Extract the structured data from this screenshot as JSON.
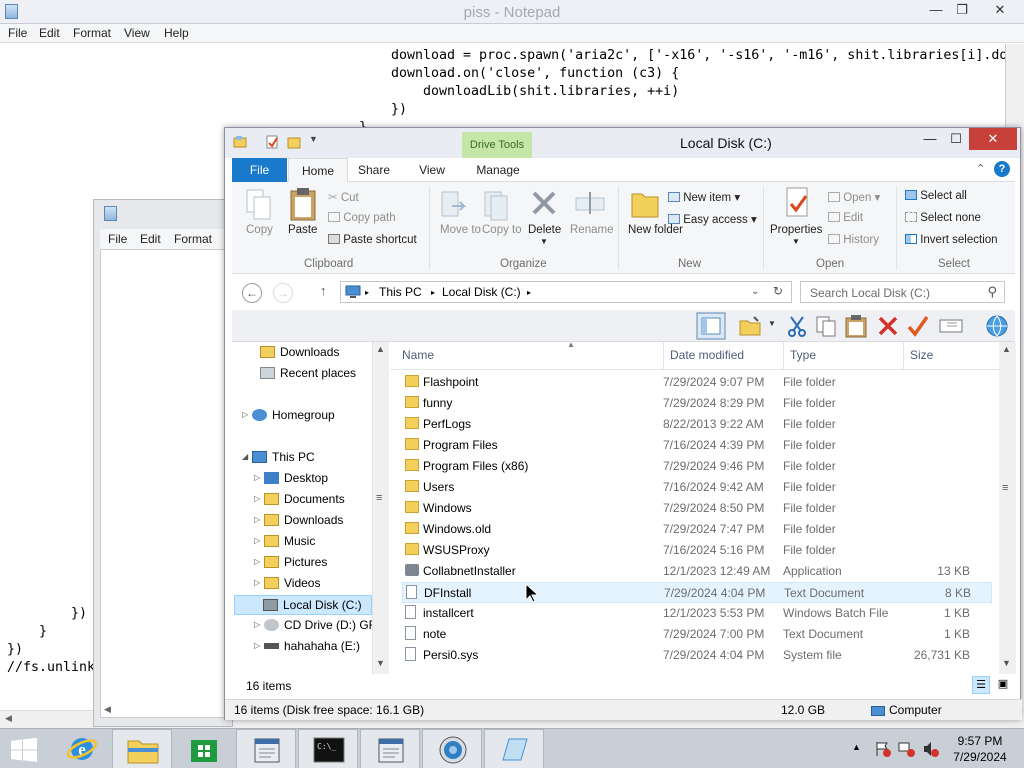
{
  "notepad": {
    "title": "piss - Notepad",
    "menu": [
      "File",
      "Edit",
      "Format",
      "View",
      "Help"
    ],
    "code_lines_top": [
      "download = proc.spawn('aria2c', ['-x16', '-s16', '-m16', shit.libraries[i].do",
      "download.on('close', function (c3) {",
      "    downloadLib(shit.libraries, ++i)",
      "})",
      "}"
    ],
    "code_lines_bottom": [
      "})",
      "}",
      "})",
      "//fs.unlink"
    ]
  },
  "notepad2": {
    "menu": [
      "File",
      "Edit",
      "Format"
    ]
  },
  "explorer": {
    "title": "Local Disk (C:)",
    "context_tab": "Drive Tools",
    "tabs": [
      "File",
      "Home",
      "Share",
      "View",
      "Manage"
    ],
    "ribbon": {
      "clipboard": {
        "label": "Clipboard",
        "copy": "Copy",
        "paste": "Paste",
        "cut": "Cut",
        "copy_path": "Copy path",
        "paste_shortcut": "Paste shortcut"
      },
      "organize": {
        "label": "Organize",
        "move_to": "Move to",
        "copy_to": "Copy to",
        "delete": "Delete",
        "rename": "Rename"
      },
      "new": {
        "label": "New",
        "new_folder": "New folder",
        "new_item": "New item",
        "easy_access": "Easy access"
      },
      "open": {
        "label": "Open",
        "properties": "Properties",
        "open": "Open",
        "edit": "Edit",
        "history": "History"
      },
      "select": {
        "label": "Select",
        "select_all": "Select all",
        "select_none": "Select none",
        "invert": "Invert selection"
      }
    },
    "address": {
      "this_pc": "This PC",
      "local_disk": "Local Disk (C:)"
    },
    "search_placeholder": "Search Local Disk (C:)",
    "nav": {
      "downloads_top": "Downloads",
      "recent": "Recent places",
      "homegroup": "Homegroup",
      "this_pc": "This PC",
      "desktop": "Desktop",
      "documents": "Documents",
      "downloads": "Downloads",
      "music": "Music",
      "pictures": "Pictures",
      "videos": "Videos",
      "local_disk": "Local Disk (C:)",
      "cd_drive": "CD Drive (D:) GRM",
      "hahahaha": "hahahaha (E:)"
    },
    "columns": {
      "name": "Name",
      "date": "Date modified",
      "type": "Type",
      "size": "Size"
    },
    "files": [
      {
        "name": "Flashpoint",
        "date": "7/29/2024 9:07 PM",
        "type": "File folder",
        "size": ""
      },
      {
        "name": "funny",
        "date": "7/29/2024 8:29 PM",
        "type": "File folder",
        "size": ""
      },
      {
        "name": "PerfLogs",
        "date": "8/22/2013 9:22 AM",
        "type": "File folder",
        "size": ""
      },
      {
        "name": "Program Files",
        "date": "7/16/2024 4:39 PM",
        "type": "File folder",
        "size": ""
      },
      {
        "name": "Program Files (x86)",
        "date": "7/29/2024 9:46 PM",
        "type": "File folder",
        "size": ""
      },
      {
        "name": "Users",
        "date": "7/16/2024 9:42 AM",
        "type": "File folder",
        "size": ""
      },
      {
        "name": "Windows",
        "date": "7/29/2024 8:50 PM",
        "type": "File folder",
        "size": ""
      },
      {
        "name": "Windows.old",
        "date": "7/29/2024 7:47 PM",
        "type": "File folder",
        "size": ""
      },
      {
        "name": "WSUSProxy",
        "date": "7/16/2024 5:16 PM",
        "type": "File folder",
        "size": ""
      },
      {
        "name": "CollabnetInstaller",
        "date": "12/1/2023 12:49 AM",
        "type": "Application",
        "size": "13 KB"
      },
      {
        "name": "DFInstall",
        "date": "7/29/2024 4:04 PM",
        "type": "Text Document",
        "size": "8 KB"
      },
      {
        "name": "installcert",
        "date": "12/1/2023 5:53 PM",
        "type": "Windows Batch File",
        "size": "1 KB"
      },
      {
        "name": "note",
        "date": "7/29/2024 7:00 PM",
        "type": "Text Document",
        "size": "1 KB"
      },
      {
        "name": "Persi0.sys",
        "date": "7/29/2024 4:04 PM",
        "type": "System file",
        "size": "26,731 KB"
      }
    ],
    "item_count": "16 items",
    "status": {
      "left": "16 items (Disk free space: 16.1 GB)",
      "size": "12.0 GB",
      "location": "Computer"
    }
  },
  "taskbar": {
    "time": "9:57 PM",
    "date": "7/29/2024"
  },
  "colors": {
    "accent": "#1979ca",
    "selection": "#cce8ff",
    "close": "#c7413a"
  }
}
